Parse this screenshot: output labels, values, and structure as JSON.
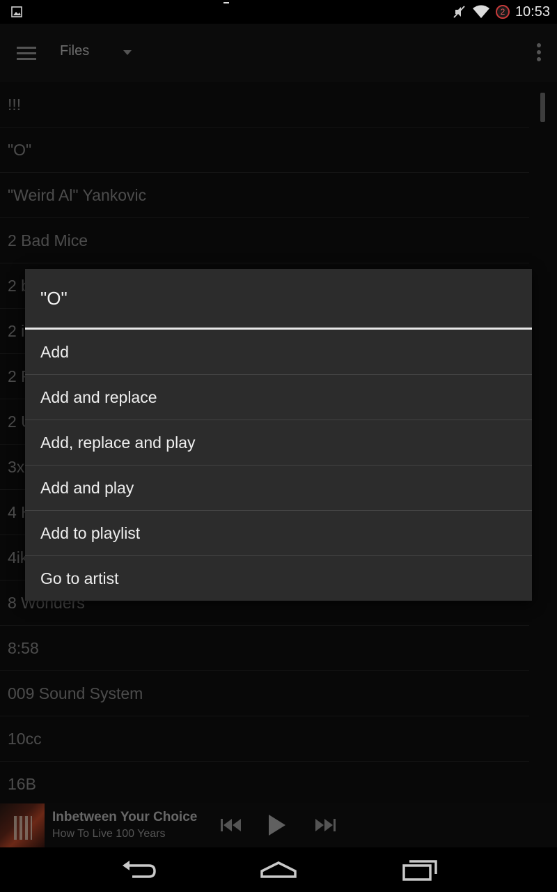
{
  "status_bar": {
    "time": "10:53",
    "notification_count": "2",
    "icons": [
      "image-icon",
      "mute-icon",
      "wifi-icon"
    ]
  },
  "action_bar": {
    "title": "Files",
    "icons": [
      "menu-icon",
      "dropdown-icon",
      "overflow-icon"
    ]
  },
  "list": {
    "items": [
      "!!!",
      "\"O\"",
      "\"Weird Al\" Yankovic",
      "2 Bad Mice",
      "2 b",
      "2 i",
      "2 F",
      "2 U",
      "3x",
      "4 H",
      "4ik",
      "8 Wonders",
      "8:58",
      "009 Sound System",
      "10cc",
      "16B"
    ]
  },
  "dialog": {
    "title": "\"O\"",
    "items": [
      "Add",
      "Add and replace",
      "Add, replace and play",
      "Add and play",
      "Add to playlist",
      "Go to artist"
    ]
  },
  "now_playing": {
    "title": "Inbetween Your Choice",
    "artist": "How To Live 100 Years",
    "icons": [
      "previous-icon",
      "play-icon",
      "next-icon"
    ]
  },
  "navigation": {
    "icons": [
      "back-icon",
      "home-icon",
      "recents-icon"
    ]
  },
  "colors": {
    "background": "#0f0f0f",
    "dialog": "#2c2c2c",
    "accent_divider": "#e8e8e8"
  }
}
